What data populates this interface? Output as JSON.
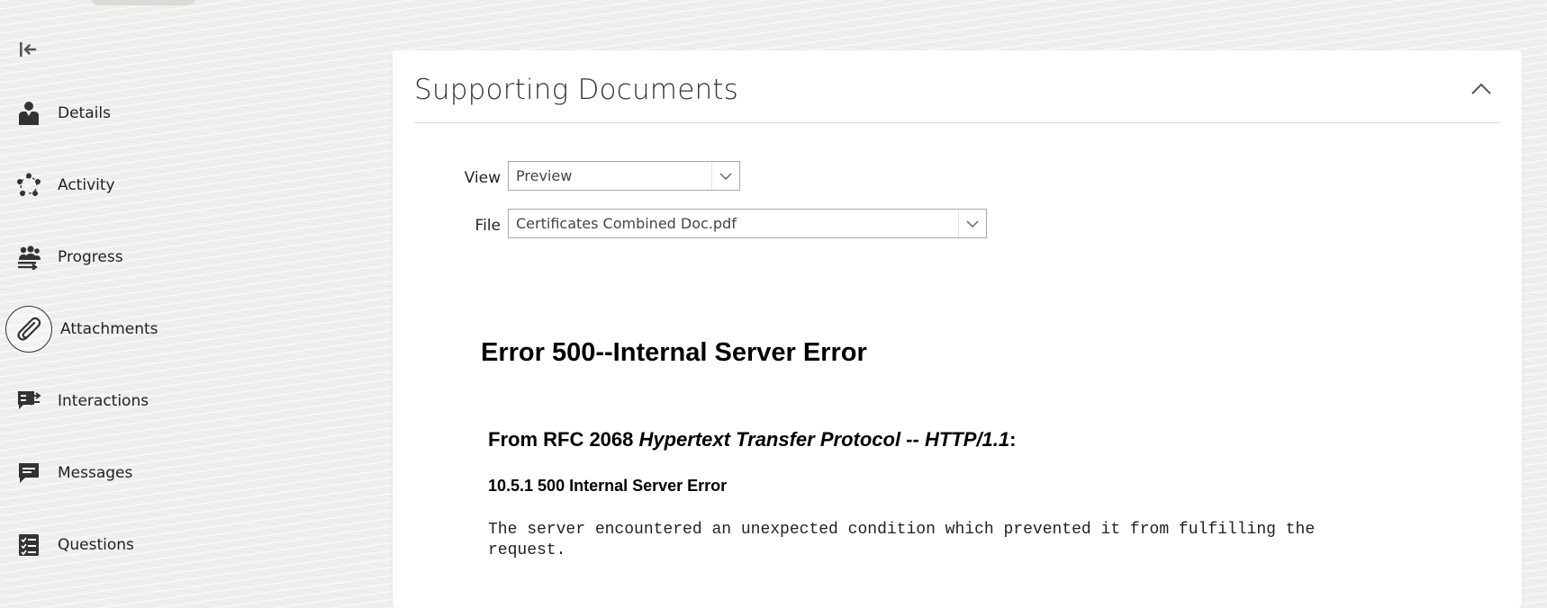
{
  "sidebar": {
    "items": [
      {
        "label": "Details",
        "icon": "person-icon"
      },
      {
        "label": "Activity",
        "icon": "activity-cycle-icon"
      },
      {
        "label": "Progress",
        "icon": "progress-team-icon"
      },
      {
        "label": "Attachments",
        "icon": "paperclip-icon",
        "active": true
      },
      {
        "label": "Interactions",
        "icon": "interactions-chat-icon"
      },
      {
        "label": "Messages",
        "icon": "message-bubble-icon"
      },
      {
        "label": "Questions",
        "icon": "checklist-icon"
      }
    ]
  },
  "panel": {
    "title": "Supporting Documents",
    "view_label": "View",
    "view_value": "Preview",
    "file_label": "File",
    "file_value": "Certificates Combined Doc.pdf"
  },
  "document": {
    "heading": "Error 500--Internal Server Error",
    "subheading_prefix": "From RFC 2068 ",
    "subheading_italic": "Hypertext Transfer Protocol -- HTTP/1.1",
    "subheading_suffix": ":",
    "section": "10.5.1 500 Internal Server Error",
    "body": "The server encountered an unexpected condition which prevented it from fulfilling the\nrequest."
  }
}
